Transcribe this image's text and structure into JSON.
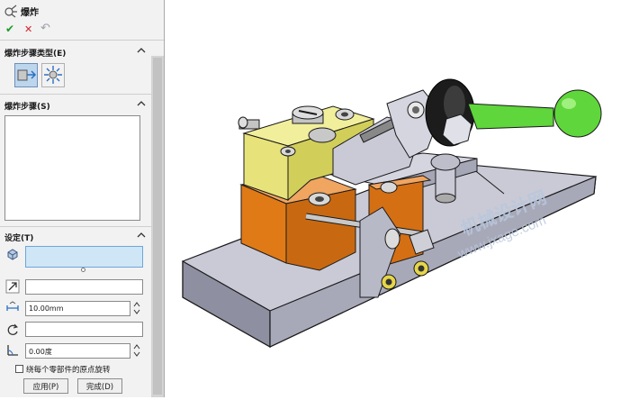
{
  "panel": {
    "title": "爆炸",
    "actions": {
      "ok": "✔",
      "cancel": "✕",
      "undo": "↶"
    },
    "section_type": {
      "label": "爆炸步骤类型(E)"
    },
    "section_steps": {
      "label": "爆炸步骤(S)"
    },
    "section_settings": {
      "label": "设定(T)",
      "distance_value": "10.00mm",
      "angle_value": "0.00度",
      "rotate_checkbox_label": "绕每个零部件的原点旋转",
      "rotate_checked": false,
      "apply_button": "应用(P)",
      "done_button": "完成(D)"
    }
  },
  "watermark": {
    "cn": "机械设计网",
    "url": "www.jxage.com"
  },
  "colors": {
    "accent_field": "#cfe6f7",
    "green_knob": "#5fd63b",
    "yellow_block": "#e7e37a",
    "orange_block": "#e07a16",
    "gray_metal": "#c9cad6"
  }
}
